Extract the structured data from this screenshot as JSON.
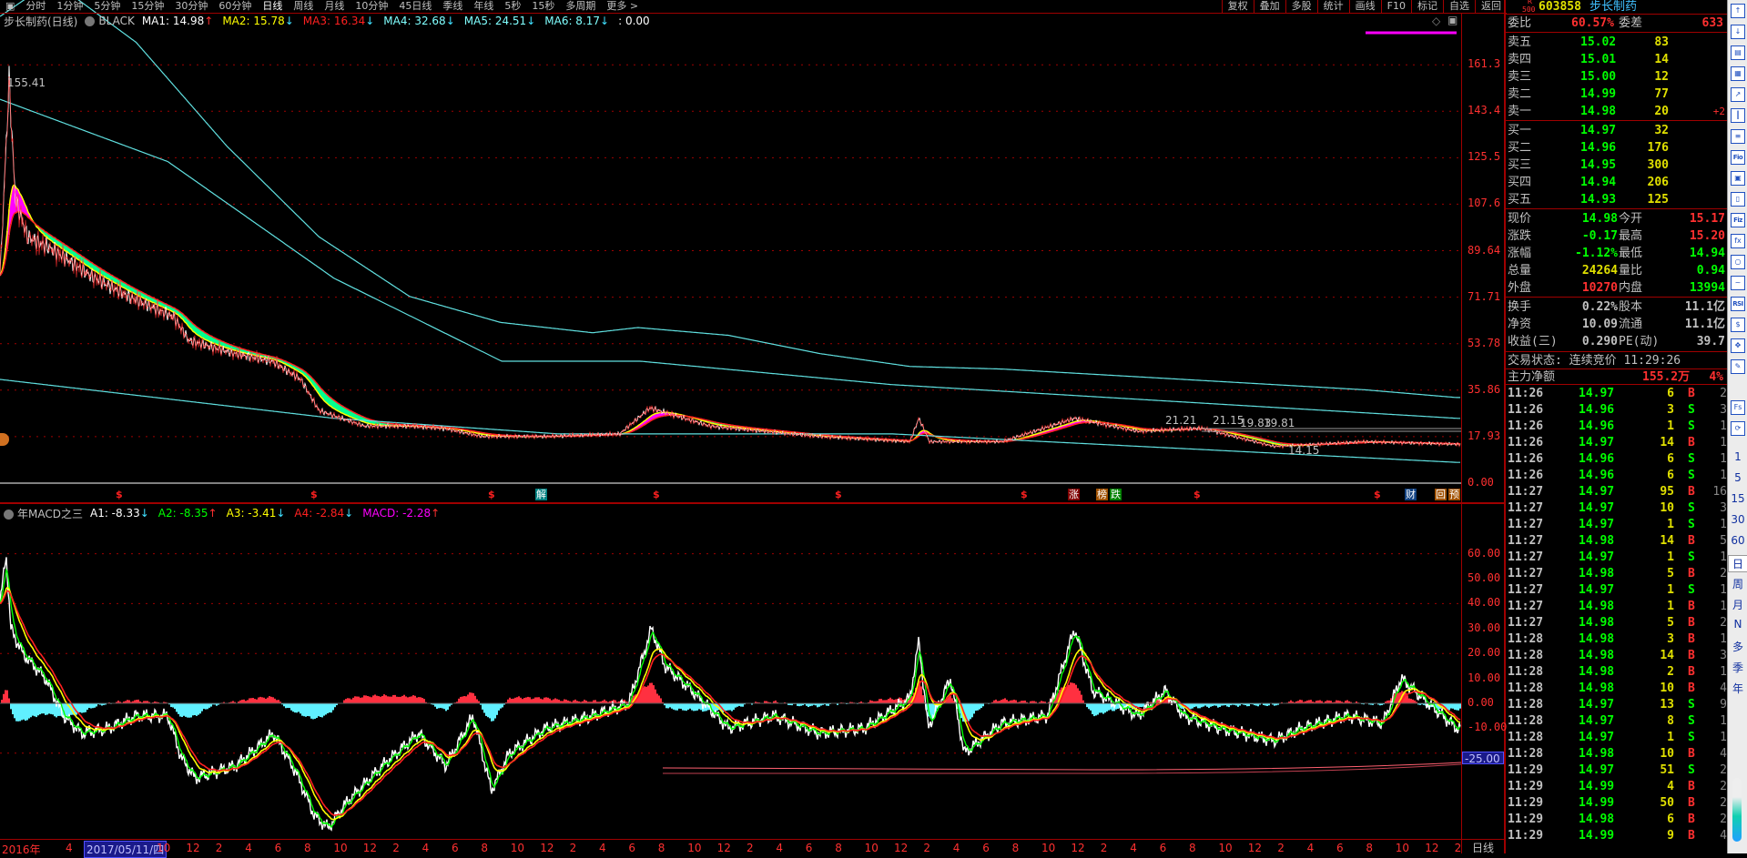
{
  "toolbar": {
    "tabs": [
      "分时",
      "1分钟",
      "5分钟",
      "15分钟",
      "30分钟",
      "60分钟",
      "日线",
      "周线",
      "月线",
      "10分钟",
      "45日线",
      "季线",
      "年线",
      "5秒",
      "15秒",
      "多周期",
      "更多 >"
    ],
    "active": "日线",
    "right": [
      "复权",
      "叠加",
      "多股",
      "统计",
      "画线",
      "F10",
      "标记",
      "自选",
      "返回"
    ]
  },
  "chart": {
    "title": "步长制药(日线)",
    "template": "BLACK",
    "ma": [
      {
        "label": "MA1: 14.98",
        "dir": "up",
        "color": "#ffffff"
      },
      {
        "label": "MA2: 15.78",
        "dir": "down",
        "color": "#ffff00"
      },
      {
        "label": "MA3: 16.34",
        "dir": "down",
        "color": "#ff2020"
      },
      {
        "label": "MA4: 32.68",
        "dir": "down",
        "color": "#80ffff"
      },
      {
        "label": "MA5: 24.51",
        "dir": "down",
        "color": "#80ffff"
      },
      {
        "label": "MA6: 8.17",
        "dir": "down",
        "color": "#80ffff"
      },
      {
        "label": ": 0.00",
        "dir": "",
        "color": "#ffffff"
      }
    ],
    "price_labels": [
      "155.41",
      "21.21",
      "21.15",
      "19.83",
      "19.81",
      "14.15"
    ],
    "y_ticks": [
      "161.3",
      "143.4",
      "125.5",
      "107.6",
      "89.64",
      "71.71",
      "53.78",
      "35.86",
      "17.93",
      "0.00"
    ],
    "signals": [
      {
        "t": "解",
        "bg": "#008080"
      },
      {
        "t": "涨",
        "bg": "#800000"
      },
      {
        "t": "榜",
        "bg": "#a05000"
      },
      {
        "t": "跌",
        "bg": "#008000"
      },
      {
        "t": "财",
        "bg": "#104080"
      },
      {
        "t": "回",
        "bg": "#a05000"
      },
      {
        "t": "预",
        "bg": "#a05000"
      }
    ]
  },
  "macd": {
    "title": "年MACD之三",
    "items": [
      {
        "label": "A1: -8.33",
        "dir": "down",
        "color": "#ffffff"
      },
      {
        "label": "A2: -8.35",
        "dir": "up",
        "color": "#00ff00"
      },
      {
        "label": "A3: -3.41",
        "dir": "down",
        "color": "#ffff00"
      },
      {
        "label": "A4: -2.84",
        "dir": "down",
        "color": "#ff2020"
      },
      {
        "label": "MACD: -2.28",
        "dir": "up",
        "color": "#ff00ff"
      }
    ],
    "y_ticks": [
      "60.00",
      "50.00",
      "40.00",
      "30.00",
      "20.00",
      "10.00",
      "0.00",
      "-10.00"
    ],
    "cursor_value": "-25.00"
  },
  "time_axis": {
    "start": "2016年",
    "first": "4",
    "cursor_date": "2017/05/11/四",
    "ticks": [
      "10",
      "12",
      "2",
      "4",
      "6",
      "8",
      "10",
      "12",
      "2",
      "4",
      "6",
      "8",
      "10",
      "12",
      "2",
      "4",
      "6",
      "8",
      "10",
      "12",
      "2",
      "4",
      "6",
      "8",
      "10",
      "12",
      "2",
      "4",
      "6",
      "8",
      "10",
      "12",
      "2",
      "4",
      "6",
      "8",
      "10",
      "12",
      "2",
      "4",
      "6",
      "8",
      "10",
      "12",
      "2"
    ],
    "period": "日线"
  },
  "chart_data": {
    "type": "line",
    "title": "步长制药(日线)",
    "x_unit": "months since 2017-01",
    "close": [
      [
        -1.5,
        80
      ],
      [
        -0.9,
        155.41
      ],
      [
        -0.5,
        110
      ],
      [
        0.3,
        95
      ],
      [
        2,
        90
      ],
      [
        4.5,
        80
      ],
      [
        7,
        72
      ],
      [
        10,
        64
      ],
      [
        11,
        55
      ],
      [
        14,
        50
      ],
      [
        16.5,
        47
      ],
      [
        18.4,
        40
      ],
      [
        19.6,
        28
      ],
      [
        22.6,
        22
      ],
      [
        25.6,
        22
      ],
      [
        28,
        21
      ],
      [
        30.4,
        18
      ],
      [
        34.6,
        18
      ],
      [
        39.5,
        19
      ],
      [
        41.5,
        29
      ],
      [
        45.5,
        22
      ],
      [
        52.7,
        18
      ],
      [
        58.7,
        16
      ],
      [
        59.3,
        25
      ],
      [
        60,
        16
      ],
      [
        64.8,
        16
      ],
      [
        69.6,
        25
      ],
      [
        73.8,
        20
      ],
      [
        78,
        21.2
      ],
      [
        82.8,
        14.15
      ],
      [
        88.8,
        16
      ],
      [
        94.9,
        15
      ]
    ],
    "upper_band": [
      [
        -1.5,
        180
      ],
      [
        1,
        190
      ],
      [
        3.3,
        188
      ],
      [
        7.5,
        170
      ],
      [
        13.5,
        130
      ],
      [
        19.6,
        95
      ],
      [
        25.6,
        72
      ],
      [
        31.6,
        62
      ],
      [
        37.7,
        58
      ],
      [
        40.7,
        60
      ],
      [
        46.7,
        57
      ],
      [
        52.7,
        50
      ],
      [
        58.7,
        45
      ],
      [
        64.8,
        44
      ],
      [
        70.8,
        42
      ],
      [
        76.8,
        40
      ],
      [
        82.8,
        38
      ],
      [
        88.8,
        36
      ],
      [
        94.9,
        33
      ]
    ],
    "middle_band": [
      [
        -1.5,
        148
      ],
      [
        9.6,
        124
      ],
      [
        20.6,
        79
      ],
      [
        31.7,
        47
      ],
      [
        40.9,
        47
      ],
      [
        57.5,
        38
      ],
      [
        94.9,
        25
      ]
    ],
    "lower_band": [
      [
        -1.5,
        40
      ],
      [
        20.6,
        25
      ],
      [
        35.4,
        19
      ],
      [
        57.5,
        19
      ],
      [
        94.9,
        8
      ]
    ],
    "macd_a1": [
      [
        -1.5,
        40
      ],
      [
        -1.1,
        60
      ],
      [
        -0.8,
        30
      ],
      [
        0,
        20
      ],
      [
        1.5,
        10
      ],
      [
        2.7,
        -5
      ],
      [
        3.9,
        -12
      ],
      [
        5.7,
        -10
      ],
      [
        7.5,
        -5
      ],
      [
        9.6,
        -5
      ],
      [
        10.5,
        -22
      ],
      [
        11.4,
        -30
      ],
      [
        14.1,
        -25
      ],
      [
        16.6,
        -12
      ],
      [
        18.1,
        -28
      ],
      [
        19.3,
        -45
      ],
      [
        20.2,
        -50
      ],
      [
        21.4,
        -40
      ],
      [
        23.8,
        -25
      ],
      [
        26.2,
        -12
      ],
      [
        28,
        -25
      ],
      [
        29.8,
        -5
      ],
      [
        31,
        -35
      ],
      [
        32.2,
        -20
      ],
      [
        34.6,
        -10
      ],
      [
        37.7,
        -5
      ],
      [
        40.1,
        0
      ],
      [
        41.6,
        30
      ],
      [
        42.5,
        15
      ],
      [
        44.3,
        5
      ],
      [
        46.7,
        -10
      ],
      [
        49.7,
        -5
      ],
      [
        52.7,
        -12
      ],
      [
        55.7,
        -10
      ],
      [
        58.7,
        2
      ],
      [
        59.3,
        25
      ],
      [
        59.9,
        -10
      ],
      [
        61.4,
        10
      ],
      [
        62.3,
        -20
      ],
      [
        64.8,
        -8
      ],
      [
        67.8,
        -5
      ],
      [
        69.6,
        30
      ],
      [
        70.8,
        5
      ],
      [
        73.8,
        -5
      ],
      [
        75.6,
        5
      ],
      [
        76.8,
        -5
      ],
      [
        79.2,
        -10
      ],
      [
        82.8,
        -15
      ],
      [
        84.6,
        -10
      ],
      [
        87.6,
        -5
      ],
      [
        90,
        -8
      ],
      [
        91.2,
        10
      ],
      [
        93,
        0
      ],
      [
        94.9,
        -10
      ]
    ],
    "macd_ylim": [
      -50,
      70
    ],
    "price_ylim": [
      0,
      180
    ]
  },
  "quote": {
    "code_prefix_top": "R",
    "code_prefix_bottom": "500",
    "code": "603858",
    "name": "步长制药",
    "weibi_label": "委比",
    "weibi": "60.57%",
    "weicha_label": "委差",
    "weicha": "633",
    "asks": [
      {
        "l": "卖五",
        "p": "15.02",
        "v": "83",
        "d": ""
      },
      {
        "l": "卖四",
        "p": "15.01",
        "v": "14",
        "d": ""
      },
      {
        "l": "卖三",
        "p": "15.00",
        "v": "12",
        "d": ""
      },
      {
        "l": "卖二",
        "p": "14.99",
        "v": "77",
        "d": ""
      },
      {
        "l": "卖一",
        "p": "14.98",
        "v": "20",
        "d": "+2"
      }
    ],
    "bids": [
      {
        "l": "买一",
        "p": "14.97",
        "v": "32"
      },
      {
        "l": "买二",
        "p": "14.96",
        "v": "176"
      },
      {
        "l": "买三",
        "p": "14.95",
        "v": "300"
      },
      {
        "l": "买四",
        "p": "14.94",
        "v": "206"
      },
      {
        "l": "买五",
        "p": "14.93",
        "v": "125"
      }
    ],
    "stats": [
      {
        "l1": "现价",
        "v1": "14.98",
        "c1": "g",
        "l2": "今开",
        "v2": "15.17",
        "c2": "r"
      },
      {
        "l1": "涨跌",
        "v1": "-0.17",
        "c1": "g",
        "l2": "最高",
        "v2": "15.20",
        "c2": "r"
      },
      {
        "l1": "涨幅",
        "v1": "-1.12%",
        "c1": "g",
        "l2": "最低",
        "v2": "14.94",
        "c2": "g"
      },
      {
        "l1": "总量",
        "v1": "24264",
        "c1": "y",
        "l2": "量比",
        "v2": "0.94",
        "c2": "g"
      },
      {
        "l1": "外盘",
        "v1": "10270",
        "c1": "r",
        "l2": "内盘",
        "v2": "13994",
        "c2": "g"
      }
    ],
    "fund": [
      {
        "l1": "换手",
        "v1": "0.22%",
        "l2": "股本",
        "v2": "11.1亿"
      },
      {
        "l1": "净资",
        "v1": "10.09",
        "l2": "流通",
        "v2": "11.1亿"
      },
      {
        "l1": "收益(三)",
        "v1": "0.290",
        "l2": "PE(动)",
        "v2": "39.7"
      }
    ],
    "status": "交易状态: 连续竞价 11:29:26",
    "net_label": "主力净额",
    "net_value": "155.2万",
    "net_pct": "4%"
  },
  "ticks": [
    [
      "11:26",
      "14.97",
      "6",
      "B",
      "2"
    ],
    [
      "11:26",
      "14.96",
      "3",
      "S",
      "3"
    ],
    [
      "11:26",
      "14.96",
      "1",
      "S",
      "1"
    ],
    [
      "11:26",
      "14.97",
      "14",
      "B",
      "1"
    ],
    [
      "11:26",
      "14.96",
      "6",
      "S",
      "1"
    ],
    [
      "11:26",
      "14.96",
      "6",
      "S",
      "1"
    ],
    [
      "11:27",
      "14.97",
      "95",
      "B",
      "16"
    ],
    [
      "11:27",
      "14.97",
      "10",
      "S",
      "3"
    ],
    [
      "11:27",
      "14.97",
      "1",
      "S",
      "1"
    ],
    [
      "11:27",
      "14.98",
      "14",
      "B",
      "5"
    ],
    [
      "11:27",
      "14.97",
      "1",
      "S",
      "1"
    ],
    [
      "11:27",
      "14.98",
      "5",
      "B",
      "2"
    ],
    [
      "11:27",
      "14.97",
      "1",
      "S",
      "1"
    ],
    [
      "11:27",
      "14.98",
      "1",
      "B",
      "1"
    ],
    [
      "11:27",
      "14.98",
      "5",
      "B",
      "2"
    ],
    [
      "11:28",
      "14.98",
      "3",
      "B",
      "1"
    ],
    [
      "11:28",
      "14.98",
      "14",
      "B",
      "3"
    ],
    [
      "11:28",
      "14.98",
      "2",
      "B",
      "1"
    ],
    [
      "11:28",
      "14.98",
      "10",
      "B",
      "4"
    ],
    [
      "11:28",
      "14.97",
      "13",
      "S",
      "9"
    ],
    [
      "11:28",
      "14.97",
      "8",
      "S",
      "1"
    ],
    [
      "11:28",
      "14.97",
      "1",
      "S",
      "1"
    ],
    [
      "11:28",
      "14.98",
      "10",
      "B",
      "4"
    ],
    [
      "11:29",
      "14.97",
      "51",
      "S",
      "2"
    ],
    [
      "11:29",
      "14.99",
      "4",
      "B",
      "2"
    ],
    [
      "11:29",
      "14.99",
      "50",
      "B",
      "2"
    ],
    [
      "11:29",
      "14.98",
      "6",
      "B",
      "2"
    ],
    [
      "11:29",
      "14.99",
      "9",
      "B",
      "4"
    ]
  ],
  "sidebar": {
    "icons": [
      "up-arrow",
      "down-arrow",
      "F10",
      "table",
      "trend",
      "kline",
      "list",
      "Fio",
      "tree",
      "notes",
      "Fiz",
      "fx",
      "circle",
      "wave",
      "RSI",
      "money",
      "move",
      "pencil",
      "Fs",
      "refresh"
    ],
    "periods": [
      "1",
      "5",
      "15",
      "30",
      "60",
      "日",
      "周",
      "月",
      "N",
      "多",
      "季",
      "年"
    ]
  }
}
